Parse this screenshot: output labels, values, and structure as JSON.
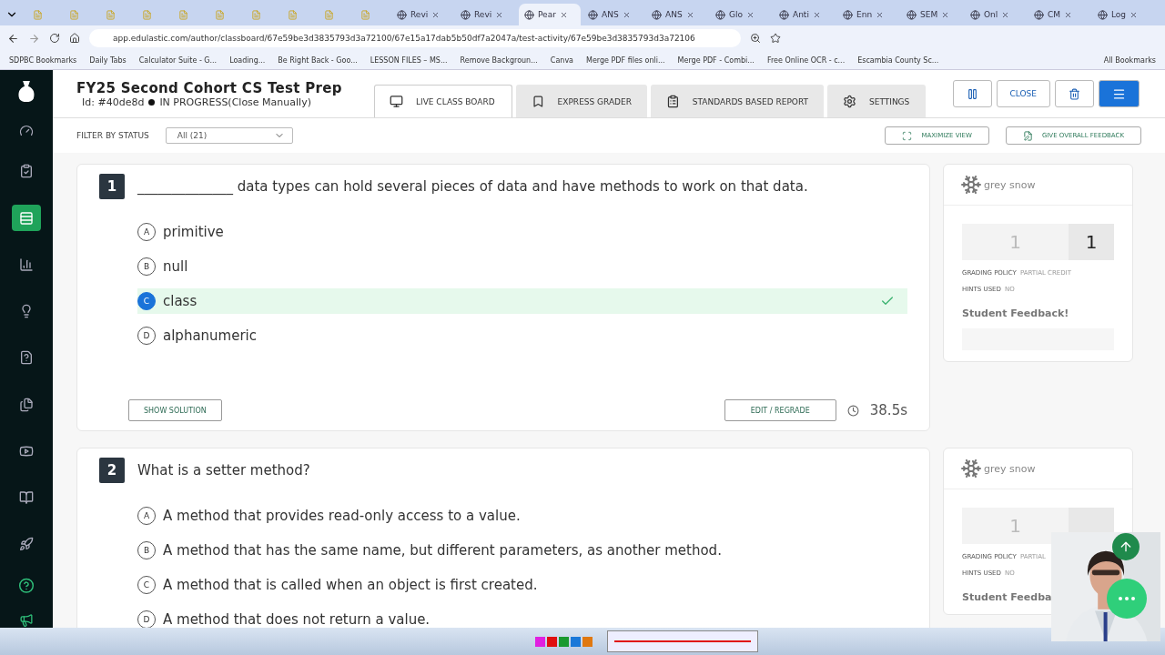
{
  "browser": {
    "tabs": [
      {
        "selected": false
      },
      {
        "selected": false
      },
      {
        "selected": false
      },
      {
        "selected": false
      },
      {
        "selected": false
      },
      {
        "selected": false
      },
      {
        "selected": false
      },
      {
        "selected": false
      },
      {
        "selected": false
      },
      {
        "selected": false
      },
      {
        "label": "Revi",
        "selected": false
      },
      {
        "label": "Revi",
        "selected": false
      },
      {
        "label": "Pear",
        "selected": true
      },
      {
        "label": "ANS",
        "selected": false
      },
      {
        "label": "ANS",
        "selected": false
      },
      {
        "label": "Glo",
        "selected": false
      },
      {
        "label": "Anti",
        "selected": false
      },
      {
        "label": "Enn",
        "selected": false
      },
      {
        "label": "SEM",
        "selected": false
      },
      {
        "label": "Onl",
        "selected": false
      },
      {
        "label": "CM",
        "selected": false
      },
      {
        "label": "Log",
        "selected": false
      }
    ],
    "url": "app.edulastic.com/author/classboard/67e59be3d3835793d3a72100/67e15a17dab5b50df7a2047a/test-activity/67e59be3d3835793d3a72106",
    "bookmarks": [
      "SDPBC Bookmarks",
      "Daily Tabs",
      "Calculator Suite - G...",
      "Loading...",
      "Be Right Back - Goo...",
      "LESSON FILES – MS...",
      "Remove Backgroun...",
      "Canva",
      "Merge PDF files onli...",
      "Merge PDF - Combi...",
      "Free Online OCR - c...",
      "Escambia County Sc..."
    ],
    "all_bookmarks": "All Bookmarks"
  },
  "sidebar": {
    "items": [
      {
        "selected": false
      },
      {
        "selected": true
      },
      {
        "selected": false
      },
      {
        "selected": false
      },
      {
        "selected": false
      },
      {
        "selected": false
      },
      {
        "selected": false
      },
      {
        "selected": false
      },
      {
        "selected": false
      }
    ]
  },
  "header": {
    "title": "FY25 Second Cohort CS Test Prep",
    "id": "Id: #40de8d",
    "status": "IN PROGRESS(Close Manually)",
    "tabs": [
      {
        "label": "LIVE CLASS BOARD",
        "selected": true
      },
      {
        "label": "EXPRESS GRADER",
        "selected": false
      },
      {
        "label": "STANDARDS BASED REPORT",
        "selected": false
      },
      {
        "label": "SETTINGS",
        "selected": false
      }
    ],
    "close": "CLOSE"
  },
  "filter": {
    "label": "FILTER BY STATUS",
    "value": "All (21)",
    "maximize": "MAXIMIZE VIEW",
    "overall_feedback": "GIVE OVERALL FEEDBACK"
  },
  "questions": [
    {
      "number": "1",
      "text": "______________ data types can hold several pieces of data and have methods to work on that data.",
      "options": [
        {
          "letter": "A",
          "text": "primitive",
          "selected": false
        },
        {
          "letter": "B",
          "text": "null",
          "selected": false
        },
        {
          "letter": "C",
          "text": "class",
          "selected": true
        },
        {
          "letter": "D",
          "text": "alphanumeric",
          "selected": false
        }
      ],
      "show_solution": "SHOW SOLUTION",
      "regrade": "EDIT / REGRADE",
      "time": "38.5s",
      "student": {
        "name": "grey snow",
        "score": "1",
        "max_score": "1",
        "grading_label": "GRADING POLICY",
        "grading_value": "PARTIAL CREDIT",
        "hints_label": "HINTS USED",
        "hints_value": "NO",
        "feedback_title": "Student Feedback!",
        "feedback_field": true
      }
    },
    {
      "number": "2",
      "text": "What is a setter method?",
      "options": [
        {
          "letter": "A",
          "text": "A method that provides read-only access to a value.",
          "selected": false
        },
        {
          "letter": "B",
          "text": "A method that has the same name, but different parameters, as another method.",
          "selected": false
        },
        {
          "letter": "C",
          "text": "A method that is called when an object is first created.",
          "selected": false
        },
        {
          "letter": "D",
          "text": "A method that does not return a value.",
          "selected": false
        }
      ],
      "student": {
        "name": "grey snow",
        "score": "1",
        "grading_label": "GRADING POLICY",
        "grading_value": "PARTIAL",
        "hints_label": "HINTS USED",
        "hints_value": "NO",
        "feedback_title": "Student Feedba"
      }
    }
  ],
  "taskbar": {
    "swatches": [
      {
        "color": "#e020e0"
      },
      {
        "color": "#e01010"
      },
      {
        "color": "#1a9a30"
      },
      {
        "color": "#1a78d8"
      },
      {
        "color": "#e07810"
      }
    ]
  }
}
